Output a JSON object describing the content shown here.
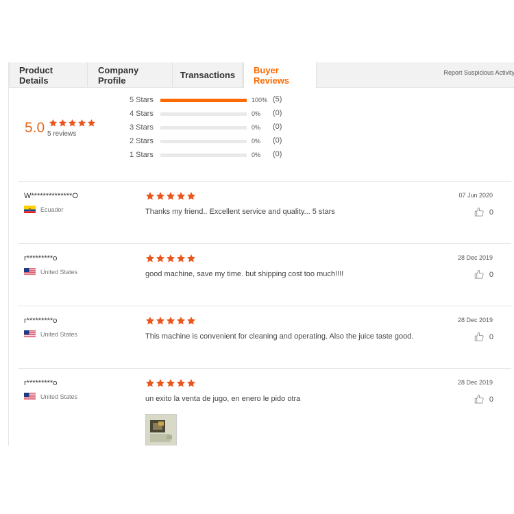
{
  "tabs": [
    {
      "label": "Product Details"
    },
    {
      "label": "Company Profile"
    },
    {
      "label": "Transactions"
    },
    {
      "label": "Buyer Reviews"
    }
  ],
  "report_link": "Report Suspicious Activity",
  "summary": {
    "score": "5.0",
    "rating_stars": 5,
    "count_text": "5 reviews",
    "distribution": [
      {
        "label": "5  Stars",
        "fraction": 1.0,
        "pct": "100%",
        "count": "(5)"
      },
      {
        "label": "4  Stars",
        "fraction": 0.0,
        "pct": "0%",
        "count": "(0)"
      },
      {
        "label": "3  Stars",
        "fraction": 0.0,
        "pct": "0%",
        "count": "(0)"
      },
      {
        "label": "2  Stars",
        "fraction": 0.0,
        "pct": "0%",
        "count": "(0)"
      },
      {
        "label": "1  Stars",
        "fraction": 0.0,
        "pct": "0%",
        "count": "(0)"
      }
    ]
  },
  "reviews": [
    {
      "name": "W**************O",
      "country": "Ecuador",
      "flag": "ecuador-flag-icon",
      "rating": 5,
      "text": "Thanks my friend.. Excellent service and quality... 5 stars",
      "date": "07 Jun 2020",
      "likes": "0"
    },
    {
      "name": "r*********o",
      "country": "United States",
      "flag": "us-flag-icon",
      "rating": 5,
      "text": "good machine, save my time. but shipping cost too much!!!!",
      "date": "28 Dec 2019",
      "likes": "0"
    },
    {
      "name": "r*********o",
      "country": "United States",
      "flag": "us-flag-icon",
      "rating": 5,
      "text": "This machine is convenient for cleaning and operating. Also the juice taste good.",
      "date": "28 Dec 2019",
      "likes": "0"
    },
    {
      "name": "r*********o",
      "country": "United States",
      "flag": "us-flag-icon",
      "rating": 5,
      "text": "un exito la venta de jugo,  en enero le pido otra",
      "date": "28 Dec 2019",
      "likes": "0"
    }
  ],
  "colors": {
    "accent": "#ff6a00",
    "star": "#e9571e",
    "score": "#e56a1e"
  }
}
